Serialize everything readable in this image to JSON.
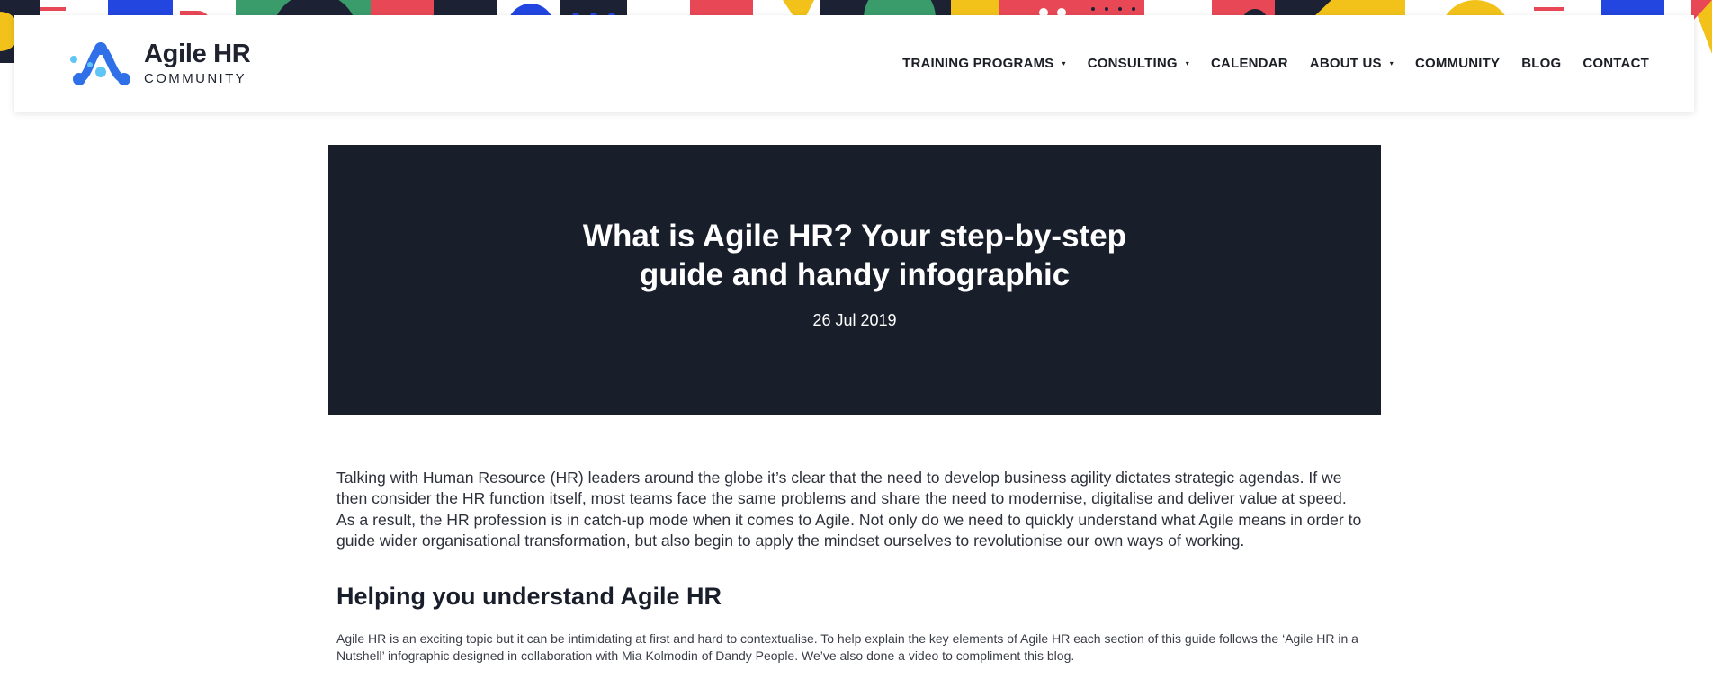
{
  "brand": {
    "title": "Agile HR",
    "subtitle": "COMMUNITY",
    "colors": {
      "logo_primary": "#2f6fe8",
      "logo_light": "#5ec5f5"
    }
  },
  "nav": {
    "items": [
      {
        "label": "TRAINING PROGRAMS",
        "dropdown": true
      },
      {
        "label": "CONSULTING",
        "dropdown": true
      },
      {
        "label": "CALENDAR",
        "dropdown": false
      },
      {
        "label": "ABOUT US",
        "dropdown": true
      },
      {
        "label": "COMMUNITY",
        "dropdown": false
      },
      {
        "label": "BLOG",
        "dropdown": false
      },
      {
        "label": "CONTACT",
        "dropdown": false
      }
    ],
    "caret": "▾"
  },
  "hero": {
    "title": "What is Agile HR? Your step-by-step guide and handy infographic",
    "date": "26 Jul 2019",
    "background": "#191e2b"
  },
  "article": {
    "intro": "Talking with Human Resource (HR) leaders around the globe it’s clear that the need to develop business agility dictates strategic agendas. If we then consider the HR function itself, most teams face the same problems and share the need to modernise, digitalise and deliver value at speed. As a result, the HR profession is in catch-up mode when it comes to Agile. Not only do we need to quickly understand what Agile means in order to guide wider organisational transformation, but also begin to apply the mindset ourselves to revolutionise our own ways of working.",
    "section_title": "Helping you understand Agile HR",
    "section_body": "Agile HR is an exciting topic but it can be intimidating at first and hard to contextualise. To help explain the key elements of Agile HR each section of this guide follows the ‘Agile HR in a Nutshell’ infographic designed in collaboration with Mia Kolmodin of Dandy People. We’ve also done a video to compliment this blog."
  }
}
